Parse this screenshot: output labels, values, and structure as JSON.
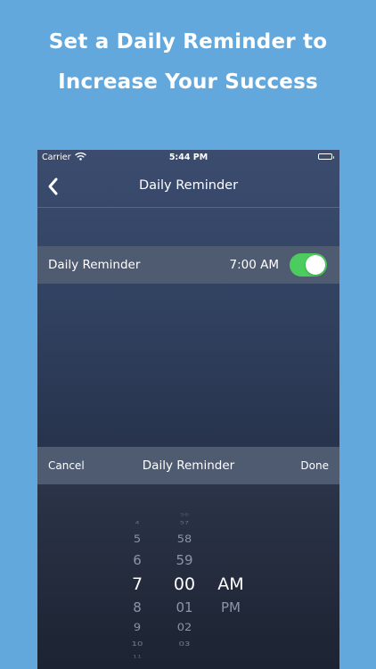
{
  "headline": {
    "line1": "Set a Daily Reminder to",
    "line2": "Increase Your Success"
  },
  "status_bar": {
    "carrier": "Carrier",
    "time": "5:44 PM",
    "icons": [
      "wifi-icon",
      "battery-icon"
    ]
  },
  "navbar": {
    "title": "Daily Reminder",
    "back_icon": "chevron-left-icon"
  },
  "reminder_row": {
    "label": "Daily Reminder",
    "time": "7:00 AM",
    "enabled": true
  },
  "picker_toolbar": {
    "cancel": "Cancel",
    "title": "Daily Reminder",
    "done": "Done"
  },
  "time_picker": {
    "hours": [
      "4",
      "5",
      "6",
      "7",
      "8",
      "9",
      "10",
      "11"
    ],
    "minutes": [
      "56",
      "57",
      "58",
      "59",
      "00",
      "01",
      "02",
      "03"
    ],
    "periods": [
      "AM",
      "PM"
    ],
    "selected": {
      "hour": "7",
      "minute": "00",
      "period": "AM"
    }
  },
  "colors": {
    "background": "#62a8dd",
    "accent_toggle": "#4ccb5e",
    "row_background": "#4f5b70",
    "screen_top": "#3b4c6f",
    "screen_bottom": "#1b2233"
  }
}
